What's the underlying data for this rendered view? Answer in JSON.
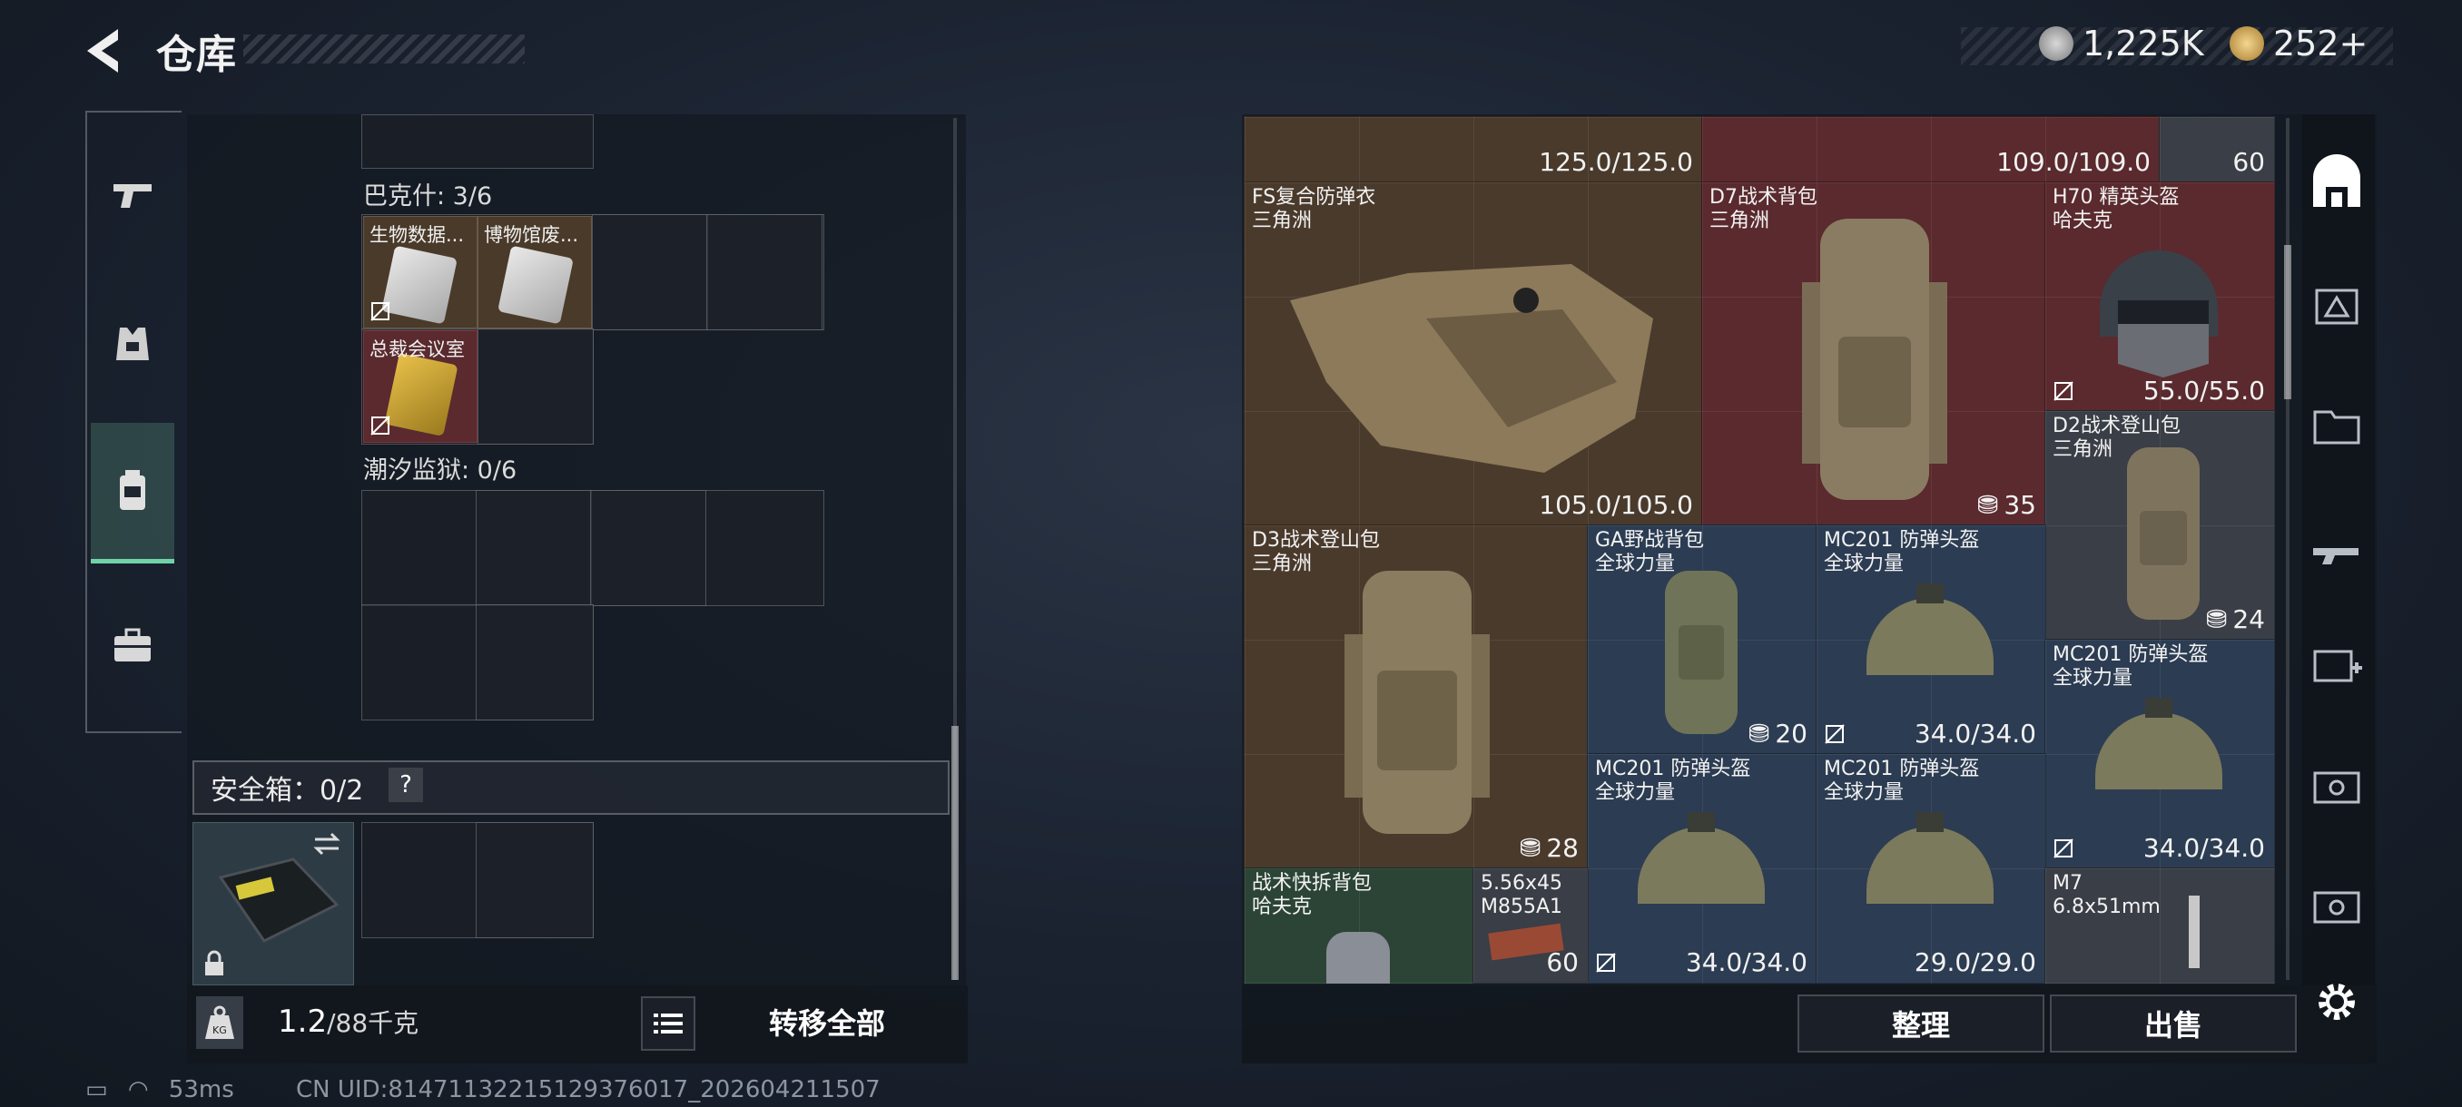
{
  "header": {
    "title": "仓库",
    "currency_silver": "1,225K",
    "currency_gold": "252+"
  },
  "left": {
    "groups": [
      {
        "label": "巴克什: 3/6"
      },
      {
        "label": "潮汐监狱: 0/6"
      }
    ],
    "items": [
      {
        "name": "生物数据..."
      },
      {
        "name": "博物馆废..."
      },
      {
        "name": "总裁会议室"
      }
    ],
    "safebox": {
      "label": "安全箱：0/2",
      "help": "?"
    },
    "weight": {
      "value": "1.2",
      "max": "/88千克"
    },
    "transfer_all": "转移全部"
  },
  "right": {
    "top_row": [
      {
        "durability": "125.0/125.0"
      },
      {
        "durability": "109.0/109.0"
      },
      {
        "count": "60"
      }
    ],
    "items": [
      {
        "name": "FS复合防弹衣",
        "map": "三角洲",
        "durability": "105.0/105.0"
      },
      {
        "name": "D7战术背包",
        "map": "三角洲",
        "count": "35"
      },
      {
        "name": "H70 精英头盔",
        "map": "哈夫克",
        "durability": "55.0/55.0"
      },
      {
        "name": "D2战术登山包",
        "map": "三角洲",
        "count": "24"
      },
      {
        "name": "D3战术登山包",
        "map": "三角洲",
        "count": "28"
      },
      {
        "name": "GA野战背包",
        "map": "全球力量",
        "count": "20"
      },
      {
        "name": "MC201 防弹头盔",
        "map": "全球力量",
        "durability": "34.0/34.0"
      },
      {
        "name": "MC201 防弹头盔",
        "map": "全球力量",
        "durability": "34.0/34.0"
      },
      {
        "name": "MC201 防弹头盔",
        "map": "全球力量",
        "durability": "34.0/34.0"
      },
      {
        "name": "MC201 防弹头盔",
        "map": "全球力量",
        "durability": "29.0/29.0"
      },
      {
        "name": "战术快拆背包",
        "map": "哈夫克"
      },
      {
        "name": "5.56x45",
        "map": "M855A1",
        "count": "60"
      },
      {
        "name": "M7",
        "map": "6.8x51mm"
      }
    ],
    "sort": "整理",
    "sell": "出售"
  },
  "status": {
    "ping": "53ms",
    "uid": "CN UID:8147113221512937601​7_202604211507"
  },
  "colors": {
    "accent": "#6fd3a8",
    "red_tile": "#5a2a2e",
    "gold_tile": "#4a3a2c",
    "blue_tile": "#2c3c52"
  }
}
